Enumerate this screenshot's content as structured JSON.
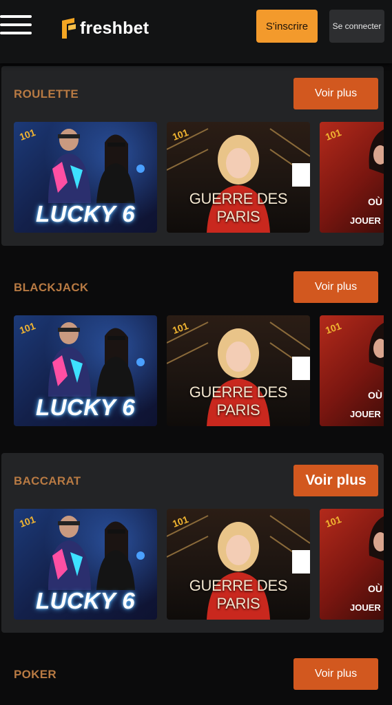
{
  "header": {
    "logo_text": "freshbet",
    "register_label": "S'inscrire",
    "login_label": "Se connecter"
  },
  "sections": [
    {
      "title": "ROULETTE",
      "more_label": "Voir plus"
    },
    {
      "title": "BLACKJACK",
      "more_label": "Voir plus"
    },
    {
      "title": "BACCARAT",
      "more_label": "Voir plus"
    },
    {
      "title": "POKER",
      "more_label": "Voir plus"
    }
  ],
  "games": {
    "lucky6": "LUCKY 6",
    "guerre": "GUERRE DES PARIS",
    "partial_line1": "OÙ",
    "partial_line2": "JOUER"
  },
  "colors": {
    "accent_orange": "#f39a2c",
    "button_red_orange": "#d2581f",
    "section_title": "#b87a43"
  }
}
